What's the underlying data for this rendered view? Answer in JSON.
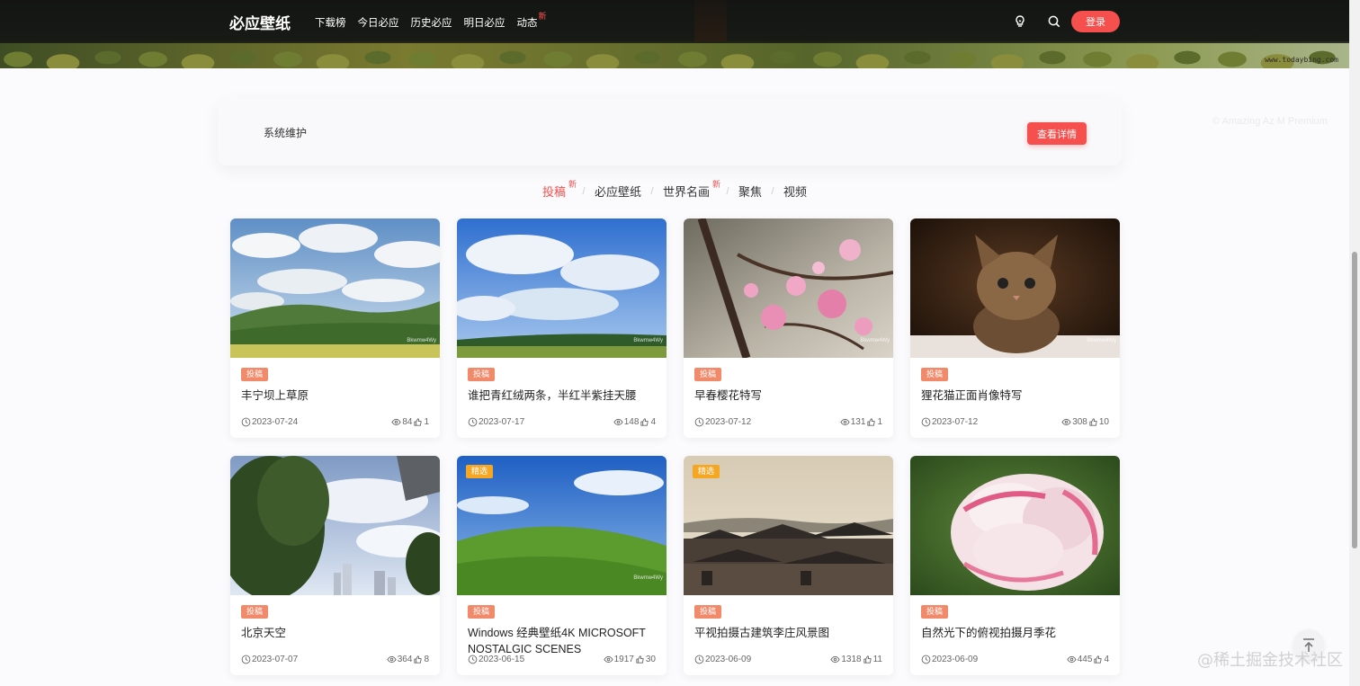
{
  "header": {
    "logo": "必应壁纸",
    "nav": [
      {
        "label": "下载榜"
      },
      {
        "label": "今日必应"
      },
      {
        "label": "历史必应"
      },
      {
        "label": "明日必应"
      },
      {
        "label": "动态",
        "badge": "新"
      }
    ],
    "login_label": "登录",
    "hero_watermark": "www.todaybing.com",
    "icons": [
      "lightbulb-icon",
      "search-icon"
    ]
  },
  "notice": {
    "text": "系统维护",
    "button_label": "查看详情",
    "faint_caption": "© Amazing Az M Premium"
  },
  "tabs": [
    {
      "label": "投稿",
      "badge": "新",
      "active": true
    },
    {
      "label": "必应壁纸"
    },
    {
      "label": "世界名画",
      "badge": "新"
    },
    {
      "label": "聚焦"
    },
    {
      "label": "视频"
    }
  ],
  "cards": [
    {
      "tag": "投稿",
      "title": "丰宁坝上草原",
      "date": "2023-07-24",
      "views": "84",
      "likes": "1",
      "thumb_mark": "Bkwmw4Wy"
    },
    {
      "tag": "投稿",
      "title": "谁把青红绒两条，半红半紫挂天腰",
      "date": "2023-07-17",
      "views": "148",
      "likes": "4",
      "thumb_mark": "Bkwmw4Wy"
    },
    {
      "tag": "投稿",
      "title": "早春樱花特写",
      "date": "2023-07-12",
      "views": "131",
      "likes": "1",
      "thumb_mark": "Bkwmw4Wy"
    },
    {
      "tag": "投稿",
      "title": "狸花猫正面肖像特写",
      "date": "2023-07-12",
      "views": "308",
      "likes": "10",
      "thumb_mark": "Bkwmw4Wy"
    },
    {
      "tag": "投稿",
      "title": "北京天空",
      "date": "2023-07-07",
      "views": "364",
      "likes": "8",
      "thumb_mark": ""
    },
    {
      "tag": "投稿",
      "top_badge": "精选",
      "title": "Windows 经典壁纸4K MICROSOFT NOSTALGIC SCENES",
      "date": "2023-06-15",
      "views": "1917",
      "likes": "30",
      "thumb_mark": "Bkwmw4Wy"
    },
    {
      "tag": "投稿",
      "top_badge": "精选",
      "title": "平视拍摄古建筑李庄风景图",
      "date": "2023-06-09",
      "views": "1318",
      "likes": "11",
      "thumb_mark": ""
    },
    {
      "tag": "投稿",
      "title": "自然光下的俯视拍摄月季花",
      "date": "2023-06-09",
      "views": "445",
      "likes": "4",
      "thumb_mark": ""
    }
  ],
  "footer_watermark": "@稀土掘金技术社区",
  "colors": {
    "accent": "#f5504d",
    "tag": "#f08a6a",
    "featured": "#f5a623"
  }
}
